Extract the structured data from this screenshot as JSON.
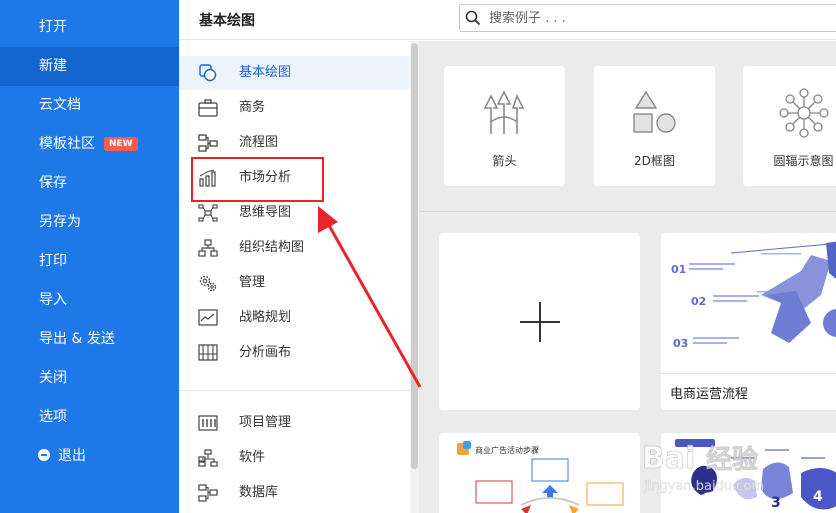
{
  "left_menu": {
    "items": [
      {
        "label": "打开"
      },
      {
        "label": "新建",
        "active": true
      },
      {
        "label": "云文档"
      },
      {
        "label": "模板社区",
        "badge": "NEW"
      },
      {
        "label": "保存"
      },
      {
        "label": "另存为"
      },
      {
        "label": "打印"
      },
      {
        "label": "导入"
      },
      {
        "label": "导出 & 发送"
      },
      {
        "label": "关闭"
      },
      {
        "label": "选项"
      },
      {
        "label": "退出",
        "icon": "minus-circle-icon"
      }
    ]
  },
  "header": {
    "title": "基本绘图",
    "search_placeholder": "搜索例子 . . ."
  },
  "categories": [
    {
      "label": "基本绘图",
      "icon": "basic-shapes-icon",
      "active": true
    },
    {
      "label": "商务",
      "icon": "briefcase-icon"
    },
    {
      "label": "流程图",
      "icon": "flowchart-icon"
    },
    {
      "label": "市场分析",
      "icon": "bar-chart-icon"
    },
    {
      "label": "思维导图",
      "icon": "mindmap-icon"
    },
    {
      "label": "组织结构图",
      "icon": "org-chart-icon"
    },
    {
      "label": "管理",
      "icon": "gears-icon"
    },
    {
      "label": "战略规划",
      "icon": "line-chart-icon"
    },
    {
      "label": "分析画布",
      "icon": "canvas-icon"
    },
    {
      "label": "项目管理",
      "icon": "gantt-icon"
    },
    {
      "label": "软件",
      "icon": "software-icon"
    },
    {
      "label": "数据库",
      "icon": "database-icon"
    }
  ],
  "basic_templates": [
    {
      "label": "箭头",
      "icon": "arrows-icon"
    },
    {
      "label": "2D框图",
      "icon": "shapes-2d-icon"
    },
    {
      "label": "圆辐示意图",
      "icon": "radial-diagram-icon"
    }
  ],
  "templates": [
    {
      "label": "",
      "icon": "plus-icon"
    },
    {
      "label": "电商运营流程",
      "preview": [
        "01",
        "02",
        "03"
      ]
    },
    {
      "preview_title": "商业广告活动步骤"
    },
    {
      "preview_numbers": [
        "1",
        "3",
        "4"
      ]
    }
  ],
  "annotation": {
    "color": "#e8242a"
  },
  "colors": {
    "menu_bg": "#1e78e8",
    "menu_active": "#1565d1",
    "badge": "#ff5a4e"
  }
}
